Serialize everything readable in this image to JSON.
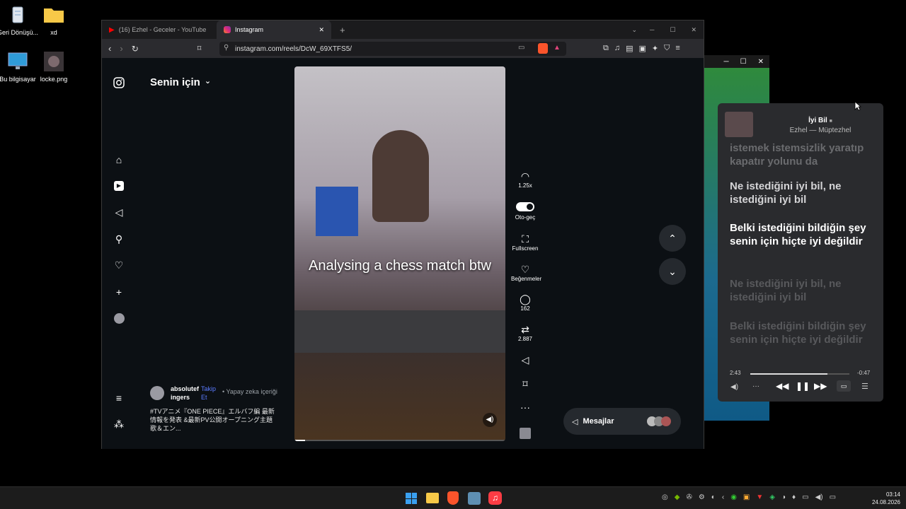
{
  "desktop": {
    "icons": [
      {
        "label": "Geri Dönüşü..."
      },
      {
        "label": "xd"
      },
      {
        "label": "Bu bilgisayar"
      },
      {
        "label": "locke.png"
      }
    ]
  },
  "browser": {
    "tabs": [
      {
        "label": "(16) Ezhel - Geceler - YouTube"
      },
      {
        "label": "Instagram"
      }
    ],
    "url": "instagram.com/reels/DcW_69XTFS5/"
  },
  "instagram": {
    "feed_title": "Senin için",
    "video_caption": "Analysing a chess match btw",
    "author": {
      "name": "absolutefingers",
      "follow": "Takip Et",
      "ai_label": "• Yapay zeka içeriği"
    },
    "description": "#TVアニメ『ONE PIECE』エルバフ編 最新情報を発表 &最新PV公開オープニング主題歌＆エン...",
    "actions": {
      "speed": "1.25x",
      "autoplay": "Oto-geç",
      "fullscreen": "Fullscreen",
      "likes": "Beğenmeler",
      "comments": "162",
      "reposts": "2.887"
    },
    "messages_label": "Mesajlar"
  },
  "music": {
    "title": "İyi Bil",
    "artist_album": "Ezhel — Müptezhel",
    "lyrics": [
      {
        "text": "istemek istemsizlik yaratıp kapatır yolunu da",
        "state": "past"
      },
      {
        "text": "Ne istediğini iyi bil, ne istediğini iyi bil",
        "state": "near"
      },
      {
        "text": "Belki istediğini bildiğin şey senin için hiçte iyi değildir",
        "state": "current"
      },
      {
        "text": "Ne istediğini iyi bil, ne istediğini iyi bil",
        "state": "future"
      },
      {
        "text": "Belki istediğini bildiğin şey senin için hiçte iyi değildir",
        "state": "future"
      }
    ],
    "elapsed": "2:43",
    "remaining": "-0:47",
    "progress": 0.78
  },
  "taskbar": {
    "time": "03:14",
    "date": "24.08.2026"
  },
  "colors": {
    "accent": "#5b7bff",
    "youtube": "#ff0000",
    "brave": "#fb542b",
    "music": "#fc3c44"
  }
}
